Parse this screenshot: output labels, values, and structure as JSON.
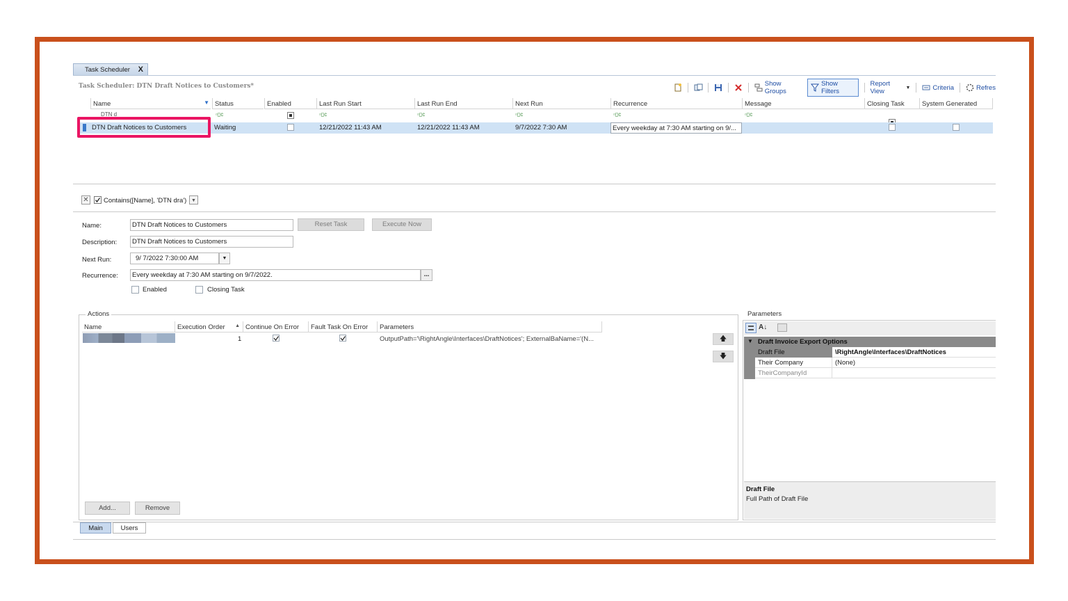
{
  "tab": {
    "label": "Task Scheduler",
    "close": "X"
  },
  "title": "Task Scheduler: DTN Draft Notices to Customers*",
  "toolbar": {
    "show_groups": "Show Groups",
    "show_filters": "Show Filters",
    "report_view": "Report View",
    "criteria": "Criteria",
    "refresh": "Refres"
  },
  "grid": {
    "columns": [
      "Name",
      "Status",
      "Enabled",
      "Last Run Start",
      "Last Run End",
      "Next Run",
      "Recurrence",
      "Message",
      "Closing Task",
      "System Generated"
    ],
    "filter_glyph": "▫▯c",
    "filter_name_partial": "DTN d",
    "row": {
      "name": "DTN Draft Notices to Customers",
      "status": "Waiting",
      "last_run_start": "12/21/2022 11:43 AM",
      "last_run_end": "12/21/2022 11:43 AM",
      "next_run": "9/7/2022 7:30 AM",
      "recurrence": "Every weekday at 7:30 AM starting on 9/..."
    }
  },
  "filter_bar": {
    "clear": "✕",
    "expression": "Contains([Name], 'DTN dra')"
  },
  "form": {
    "name_label": "Name:",
    "name_value": "DTN Draft Notices to Customers",
    "description_label": "Description:",
    "description_value": "DTN Draft Notices to Customers",
    "next_run_label": "Next Run:",
    "next_run_value": "9/  7/2022   7:30:00  AM",
    "recurrence_label": "Recurrence:",
    "recurrence_value": "Every weekday at 7:30 AM starting on 9/7/2022.",
    "ellipsis": "...",
    "enabled_label": "Enabled",
    "closing_label": "Closing Task",
    "reset_task": "Reset Task",
    "execute_now": "Execute Now"
  },
  "actions": {
    "legend": "Actions",
    "columns": [
      "Name",
      "Execution Order",
      "Continue On Error",
      "Fault Task On Error",
      "Parameters"
    ],
    "row": {
      "order": "1",
      "parameters": "OutputPath='\\RightAngle\\Interfaces\\DraftNotices'; ExternalBaName='(N..."
    },
    "add": "Add...",
    "remove": "Remove"
  },
  "parameters": {
    "legend": "Parameters",
    "category": "Draft Invoice Export Options",
    "rows": [
      {
        "name": "Draft File",
        "value": "\\RightAngle\\Interfaces\\DraftNotices"
      },
      {
        "name": "Their Company",
        "value": "(None)"
      },
      {
        "name": "TheirCompanyId",
        "value": ""
      }
    ],
    "desc_title": "Draft File",
    "desc_text": "Full Path of Draft File"
  },
  "bottom_tabs": [
    "Main",
    "Users"
  ],
  "colors": {
    "frame": "#c9501c",
    "highlight": "#ea1563",
    "selection": "#cfe2f5",
    "link": "#1f4ea3"
  }
}
